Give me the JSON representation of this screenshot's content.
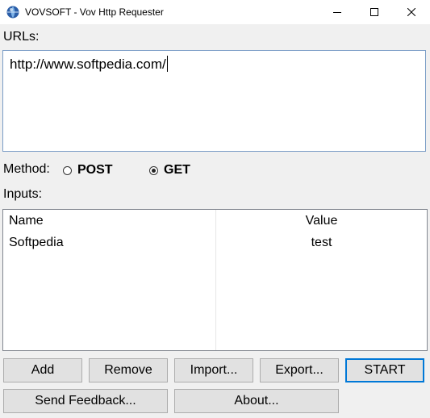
{
  "window": {
    "title": "VOVSOFT - Vov Http Requester",
    "icon": "globe-icon"
  },
  "urls": {
    "label": "URLs:",
    "value": "http://www.softpedia.com/"
  },
  "method": {
    "label": "Method:",
    "options": [
      {
        "label": "POST",
        "checked": false
      },
      {
        "label": "GET",
        "checked": true
      }
    ]
  },
  "inputs": {
    "label": "Inputs:",
    "columns": [
      "Name",
      "Value"
    ],
    "rows": [
      {
        "name": "Softpedia",
        "value": "test"
      }
    ]
  },
  "buttons": {
    "add": "Add",
    "remove": "Remove",
    "import": "Import...",
    "export": "Export...",
    "start": "START",
    "feedback": "Send Feedback...",
    "about": "About..."
  },
  "colors": {
    "accent": "#0078d7",
    "window_bg": "#f0f0f0"
  }
}
